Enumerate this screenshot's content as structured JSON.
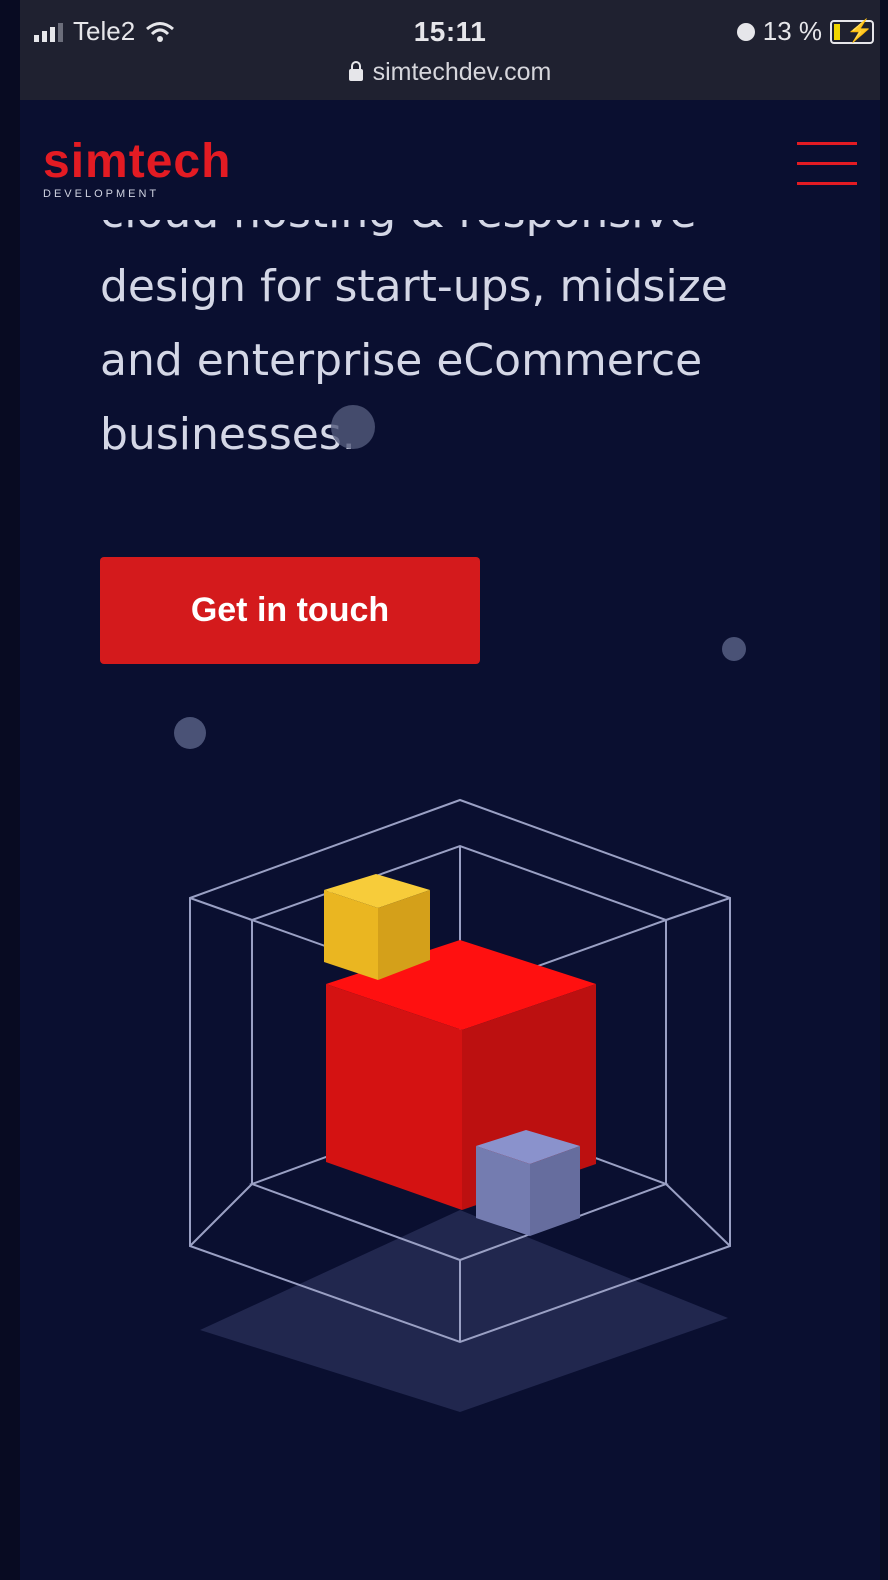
{
  "status_bar": {
    "carrier": "Tele2",
    "time": "15:11",
    "url": "simtechdev.com",
    "battery": "13 %"
  },
  "header": {
    "logo_main": "simtech",
    "logo_sub": "DEVELOPMENT"
  },
  "hero": {
    "line_partial": "cloud hosting & responsive",
    "line_1": "design for start-ups, midsize",
    "line_2": "and enterprise eCommerce",
    "line_3": "businesses."
  },
  "cta": {
    "label": "Get in touch"
  },
  "colors": {
    "background": "#0a0f30",
    "brand_red": "#e31b23",
    "cube_red": "#e41616",
    "cube_yellow": "#f0c020",
    "cube_blue": "#7c84b8"
  },
  "icons": [
    "signal-icon",
    "wifi-icon",
    "lock-icon",
    "alarm-icon",
    "battery-icon",
    "menu-icon"
  ]
}
